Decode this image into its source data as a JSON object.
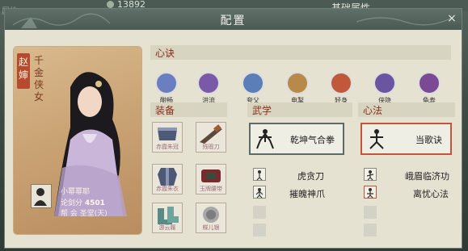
{
  "background": {
    "currency_value": "13892",
    "left_text": "属性",
    "right_title": "基础属性"
  },
  "dialog": {
    "title": "配置",
    "close_icon": "close-icon"
  },
  "character": {
    "name": "赵婶",
    "title": "千金侠女",
    "player_name": "小幂幂耶",
    "rank_label": "论剑分",
    "rank_value": "4501",
    "guild": "帮  会 圣堂(天)"
  },
  "xinjue": {
    "label": "心诀",
    "items": [
      {
        "label": "酣畅",
        "color": "#6b7fc0"
      },
      {
        "label": "洪流",
        "color": "#7a5aa8"
      },
      {
        "label": "夸父",
        "color": "#5a7fb8"
      },
      {
        "label": "电掣",
        "color": "#b88a4a"
      },
      {
        "label": "轻身",
        "color": "#c0583a"
      },
      {
        "label": "侠隐",
        "color": "#6a55a0"
      },
      {
        "label": "龟寿",
        "color": "#7a4a95"
      }
    ]
  },
  "equipment": {
    "label": "装备",
    "items": [
      {
        "label": "赤霞朱冠"
      },
      {
        "label": "残瑕刀"
      },
      {
        "label": "赤霞朱衣"
      },
      {
        "label": "玉牌腰带"
      },
      {
        "label": "游云履"
      },
      {
        "label": "蝶儿银"
      }
    ]
  },
  "wuxue": {
    "label": "武学",
    "main": "乾坤气合拳",
    "sub": [
      "虎贪刀",
      "摧魄神爪"
    ]
  },
  "xinfa": {
    "label": "心法",
    "main": "当歌诀",
    "sub": [
      "峨眉临济功",
      "离忧心法"
    ]
  }
}
